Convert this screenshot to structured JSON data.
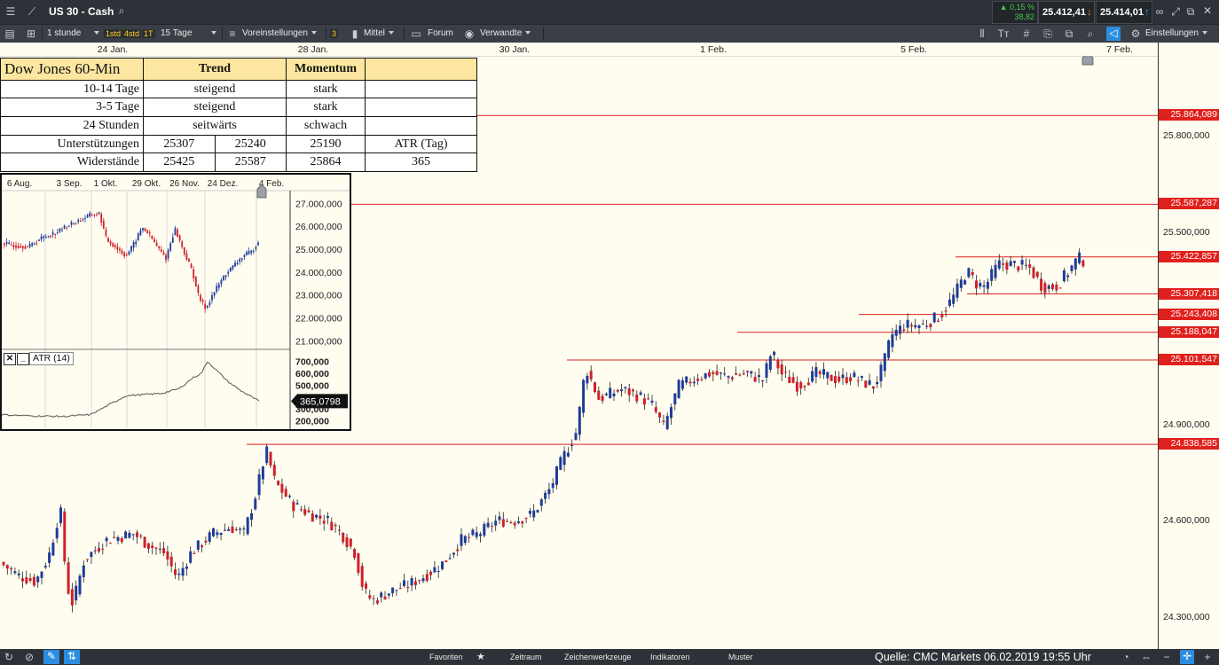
{
  "app": {
    "instrument": "US 30 - Cash",
    "change_pct": "▲ 0,15 %",
    "change_pts": "38,82",
    "sell": "25.412,41",
    "buy": "25.414,01"
  },
  "toolbar": {
    "interval": "1 stunde",
    "chip1": "1std",
    "chip2": "4std",
    "chip3": "1T",
    "range": "15 Tage",
    "presets": "Voreinstellungen",
    "count": "3",
    "detail": "Mittel",
    "forum": "Forum",
    "related": "Verwandte",
    "settings": "Einstellungen"
  },
  "bottom": {
    "favorites": "Favoriten",
    "timeframe": "Zeitraum",
    "drawing_tools": "Zeichenwerkzeuge",
    "indicators": "Indikatoren",
    "patterns": "Muster",
    "source": "Quelle: CMC Markets 06.02.2019 19:55 Uhr"
  },
  "table": {
    "title": "Dow Jones 60-Min",
    "col_trend": "Trend",
    "col_momentum": "Momentum",
    "rows": [
      {
        "label": "10-14 Tage",
        "trend": "steigend",
        "momentum": "stark"
      },
      {
        "label": "3-5 Tage",
        "trend": "steigend",
        "momentum": "stark"
      },
      {
        "label": "24 Stunden",
        "trend": "seitwärts",
        "momentum": "schwach"
      }
    ],
    "support_label": "Unterstützungen",
    "supports": [
      "25307",
      "25240",
      "25190"
    ],
    "resistance_label": "Widerstände",
    "resistances": [
      "25425",
      "25587",
      "25864"
    ],
    "atr_label": "ATR (Tag)",
    "atr_value": "365"
  },
  "chart_data": [
    {
      "type": "candlestick",
      "title": "",
      "x_ticks": [
        "24 Jan.",
        "28 Jan.",
        "30 Jan.",
        "1 Feb.",
        "5 Feb.",
        "7 Feb."
      ],
      "y_ticks": [
        "25.800,000",
        "25.500,000",
        "24.900,000",
        "24.600,000",
        "24.300,000"
      ],
      "ylim": [
        24200,
        26050
      ],
      "price_levels": [
        "25.864,089",
        "25.587,287",
        "25.422,857",
        "25.307,418",
        "25.243,408",
        "25.188,047",
        "25.101,547",
        "24.838,585"
      ],
      "level_values": [
        25864.089,
        25587.287,
        25422.857,
        25307.418,
        25243.408,
        25188.047,
        25101.547,
        24838.585
      ],
      "colors": {
        "up": "#1f3c9a",
        "down": "#d0202a",
        "level": "#e0201c"
      },
      "close_path": [
        [
          0,
          24470
        ],
        [
          20,
          24430
        ],
        [
          40,
          24410
        ],
        [
          55,
          24490
        ],
        [
          68,
          24640
        ],
        [
          75,
          24400
        ],
        [
          82,
          24340
        ],
        [
          95,
          24480
        ],
        [
          120,
          24540
        ],
        [
          150,
          24560
        ],
        [
          170,
          24520
        ],
        [
          185,
          24500
        ],
        [
          200,
          24420
        ],
        [
          215,
          24500
        ],
        [
          240,
          24560
        ],
        [
          260,
          24580
        ],
        [
          275,
          24560
        ],
        [
          288,
          24680
        ],
        [
          300,
          24820
        ],
        [
          310,
          24720
        ],
        [
          330,
          24650
        ],
        [
          350,
          24620
        ],
        [
          370,
          24600
        ],
        [
          385,
          24560
        ],
        [
          400,
          24500
        ],
        [
          410,
          24380
        ],
        [
          420,
          24350
        ],
        [
          440,
          24380
        ],
        [
          460,
          24400
        ],
        [
          480,
          24430
        ],
        [
          500,
          24470
        ],
        [
          520,
          24540
        ],
        [
          540,
          24560
        ],
        [
          560,
          24600
        ],
        [
          580,
          24600
        ],
        [
          600,
          24620
        ],
        [
          620,
          24700
        ],
        [
          635,
          24800
        ],
        [
          650,
          24880
        ],
        [
          660,
          25080
        ],
        [
          675,
          24980
        ],
        [
          700,
          25010
        ],
        [
          720,
          24990
        ],
        [
          735,
          24960
        ],
        [
          748,
          24890
        ],
        [
          765,
          25020
        ],
        [
          780,
          25040
        ],
        [
          800,
          25060
        ],
        [
          820,
          25050
        ],
        [
          840,
          25060
        ],
        [
          860,
          25040
        ],
        [
          870,
          25130
        ],
        [
          880,
          25060
        ],
        [
          900,
          25020
        ],
        [
          920,
          25060
        ],
        [
          945,
          25040
        ],
        [
          960,
          25050
        ],
        [
          975,
          25030
        ],
        [
          985,
          25020
        ],
        [
          995,
          25080
        ],
        [
          1005,
          25180
        ],
        [
          1020,
          25210
        ],
        [
          1040,
          25210
        ],
        [
          1060,
          25240
        ],
        [
          1075,
          25300
        ],
        [
          1090,
          25380
        ],
        [
          1100,
          25340
        ],
        [
          1110,
          25330
        ],
        [
          1125,
          25400
        ],
        [
          1140,
          25400
        ],
        [
          1160,
          25390
        ],
        [
          1175,
          25330
        ],
        [
          1190,
          25330
        ],
        [
          1205,
          25380
        ],
        [
          1215,
          25420
        ],
        [
          1222,
          25410
        ]
      ]
    },
    {
      "type": "candlestick",
      "title": "",
      "x_ticks": [
        "6 Aug.",
        "3 Sep.",
        "1 Okt.",
        "29 Okt.",
        "26 Nov.",
        "24 Dez.",
        "4 Feb."
      ],
      "y_ticks": [
        "27.000,000",
        "26.000,000",
        "25.000,000",
        "24.000,000",
        "23.000,000",
        "22.000,000",
        "21.000,000"
      ],
      "ylim": [
        20700,
        27400
      ],
      "close_path": [
        [
          2,
          25250
        ],
        [
          15,
          25150
        ],
        [
          30,
          25100
        ],
        [
          45,
          25500
        ],
        [
          60,
          25700
        ],
        [
          75,
          26050
        ],
        [
          90,
          26300
        ],
        [
          100,
          26500
        ],
        [
          110,
          26550
        ],
        [
          118,
          25400
        ],
        [
          128,
          25100
        ],
        [
          140,
          24700
        ],
        [
          150,
          25300
        ],
        [
          158,
          25950
        ],
        [
          165,
          25700
        ],
        [
          175,
          25100
        ],
        [
          185,
          24600
        ],
        [
          195,
          25900
        ],
        [
          205,
          24900
        ],
        [
          215,
          24000
        ],
        [
          222,
          22900
        ],
        [
          230,
          22400
        ],
        [
          236,
          22900
        ],
        [
          242,
          23300
        ],
        [
          252,
          23900
        ],
        [
          262,
          24300
        ],
        [
          272,
          24700
        ],
        [
          282,
          24900
        ],
        [
          290,
          25400
        ]
      ]
    },
    {
      "type": "line",
      "title": "ATR (14)",
      "y_ticks": [
        "700,000",
        "600,000",
        "500,000",
        "300,000",
        "200,000"
      ],
      "ylim": [
        150,
        780
      ],
      "current_value": "365,0798",
      "values": [
        [
          0,
          250
        ],
        [
          30,
          240
        ],
        [
          70,
          235
        ],
        [
          100,
          250
        ],
        [
          120,
          330
        ],
        [
          140,
          410
        ],
        [
          160,
          420
        ],
        [
          180,
          430
        ],
        [
          200,
          470
        ],
        [
          215,
          560
        ],
        [
          225,
          600
        ],
        [
          232,
          700
        ],
        [
          240,
          640
        ],
        [
          255,
          530
        ],
        [
          270,
          450
        ],
        [
          290,
          365
        ]
      ]
    }
  ]
}
